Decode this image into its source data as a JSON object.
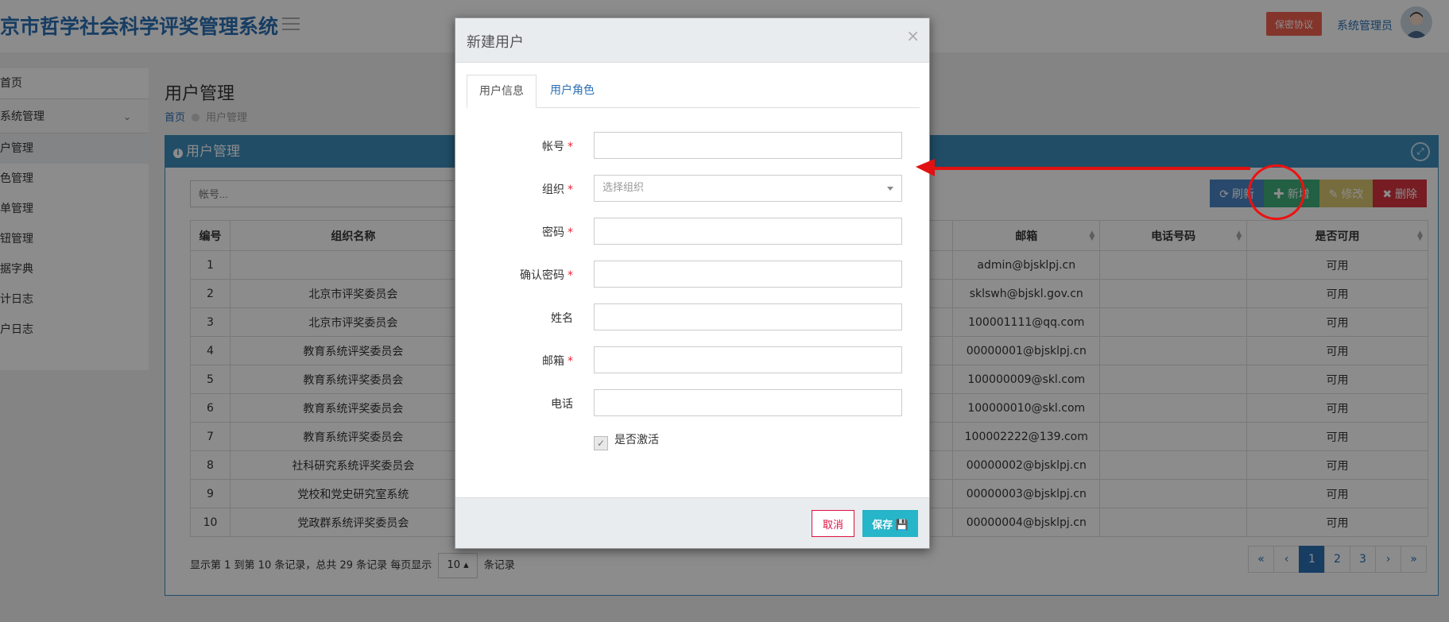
{
  "header": {
    "app_title": "京市哲学社会科学评奖管理系统",
    "secret_label": "保密协议",
    "admin_name": "系统管理员"
  },
  "sidebar": {
    "items": [
      {
        "label": "首页"
      },
      {
        "label": "系统管理"
      },
      {
        "label": "户管理"
      },
      {
        "label": "色管理"
      },
      {
        "label": "单管理"
      },
      {
        "label": "钮管理"
      },
      {
        "label": "据字典"
      },
      {
        "label": "计日志"
      },
      {
        "label": "户日志"
      }
    ]
  },
  "page": {
    "title": "用户管理",
    "breadcrumb_home": "首页",
    "breadcrumb_current": "用户管理"
  },
  "panel": {
    "title": "用户管理",
    "search_placeholder": "帐号...",
    "toolbar": {
      "refresh": "刷新",
      "add": "新增",
      "edit": "修改",
      "delete": "删除"
    }
  },
  "table": {
    "headers": [
      "编号",
      "组织名称",
      "邮箱",
      "电话号码",
      "是否可用"
    ],
    "rows": [
      {
        "id": "1",
        "org": "",
        "email": "admin@bjsklpj.cn",
        "phone": "",
        "enabled": "可用"
      },
      {
        "id": "2",
        "org": "北京市评奖委员会",
        "email": "sklswh@bjskl.gov.cn",
        "phone": "",
        "enabled": "可用"
      },
      {
        "id": "3",
        "org": "北京市评奖委员会",
        "email": "100001111@qq.com",
        "phone": "",
        "enabled": "可用"
      },
      {
        "id": "4",
        "org": "教育系统评奖委员会",
        "email": "00000001@bjsklpj.cn",
        "phone": "",
        "enabled": "可用"
      },
      {
        "id": "5",
        "org": "教育系统评奖委员会",
        "email": "100000009@skl.com",
        "phone": "",
        "enabled": "可用"
      },
      {
        "id": "6",
        "org": "教育系统评奖委员会",
        "email": "100000010@skl.com",
        "phone": "",
        "enabled": "可用"
      },
      {
        "id": "7",
        "org": "教育系统评奖委员会",
        "email": "100002222@139.com",
        "phone": "",
        "enabled": "可用"
      },
      {
        "id": "8",
        "org": "社科研究系统评奖委员会",
        "email": "00000002@bjsklpj.cn",
        "phone": "",
        "enabled": "可用"
      },
      {
        "id": "9",
        "org": "党校和党史研究室系统",
        "email": "00000003@bjsklpj.cn",
        "phone": "",
        "enabled": "可用"
      },
      {
        "id": "10",
        "org": "党政群系统评奖委员会",
        "email": "00000004@bjsklpj.cn",
        "phone": "",
        "enabled": "可用"
      }
    ]
  },
  "pager": {
    "info_prefix": "显示第 1 到第 10 条记录，总共 29 条记录 每页显示",
    "page_size": "10",
    "info_suffix": "条记录",
    "pages": [
      "«",
      "‹",
      "1",
      "2",
      "3",
      "›",
      "»"
    ],
    "active_page": "1"
  },
  "modal": {
    "title": "新建用户",
    "close": "×",
    "tabs": [
      "用户信息",
      "用户角色"
    ],
    "fields": [
      {
        "label": "帐号",
        "required": true,
        "value": ""
      },
      {
        "label": "组织",
        "required": true,
        "value": "",
        "placeholder": "选择组织"
      },
      {
        "label": "密码",
        "required": true,
        "value": ""
      },
      {
        "label": "确认密码",
        "required": true,
        "value": ""
      },
      {
        "label": "姓名",
        "required": false,
        "value": ""
      },
      {
        "label": "邮箱",
        "required": true,
        "value": ""
      },
      {
        "label": "电话",
        "required": false,
        "value": ""
      }
    ],
    "required_mark": "*",
    "active_label": "是否激活",
    "active_checked": true,
    "cancel": "取消",
    "save": "保存"
  },
  "colors": {
    "primary": "#2a70b5",
    "panel_header": "#3c8dbc",
    "add_button": "#3fae7a",
    "delete_button": "#d7333f",
    "save_button": "#26b5c9",
    "annotation": "#e11111"
  }
}
